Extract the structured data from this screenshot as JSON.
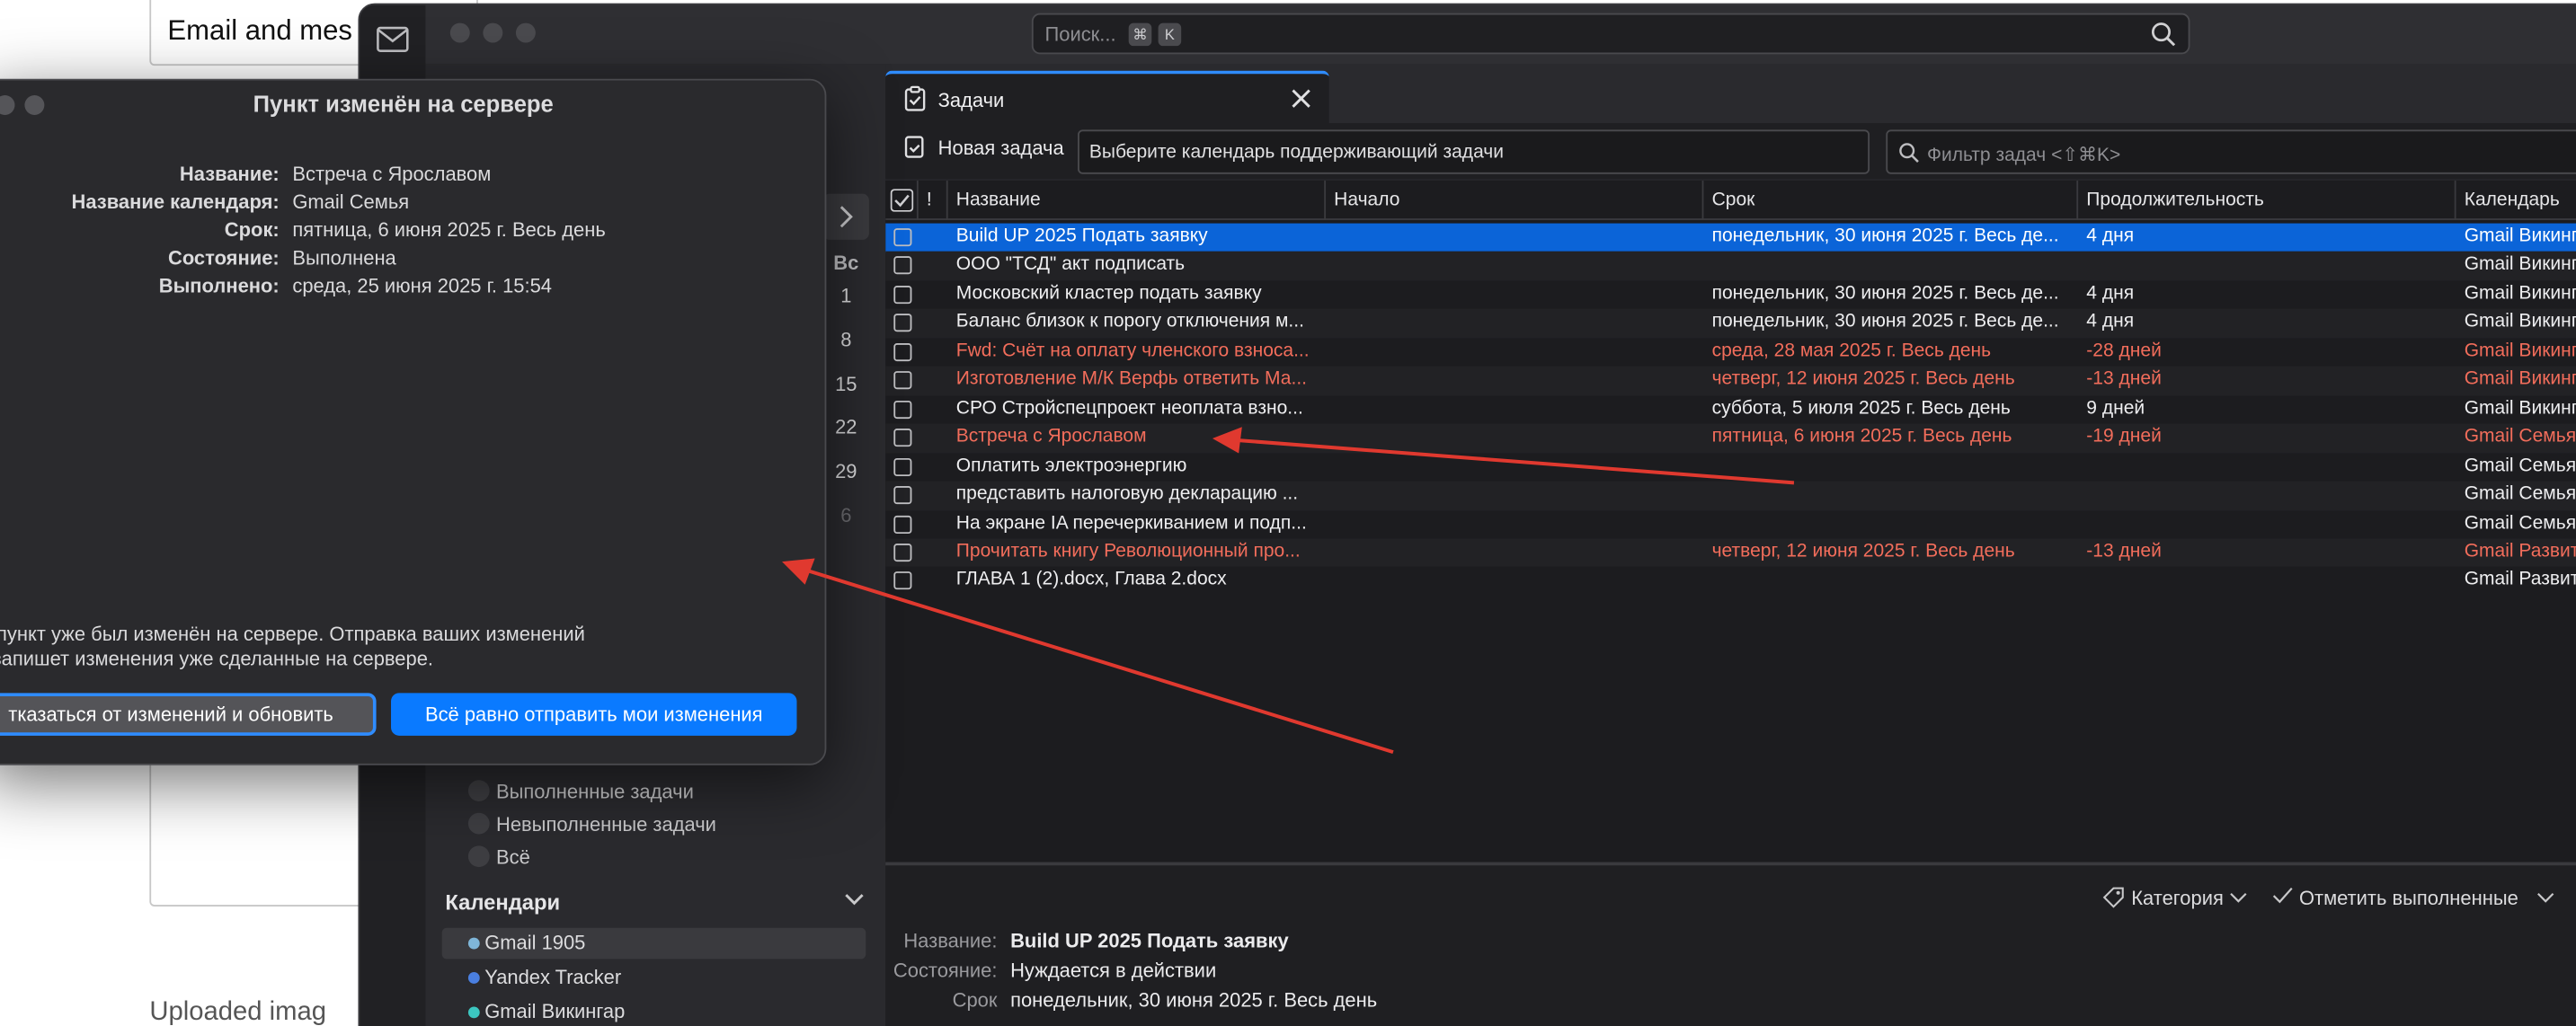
{
  "background": {
    "top_box_text": "Email and mes",
    "bottom_text": "Uploaded imag"
  },
  "app": {
    "search": {
      "placeholder": "Поиск...",
      "key1": "⌘",
      "key2": "K"
    },
    "mini_calendar": {
      "header": "Вс",
      "days": [
        "1",
        "8",
        "15",
        "22",
        "29",
        "6"
      ]
    },
    "filters": [
      {
        "label": "Выполненные задачи"
      },
      {
        "label": "Невыполненные задачи"
      },
      {
        "label": "Всё"
      }
    ],
    "calendars": {
      "title": "Календари",
      "items": [
        {
          "label": "Gmail 1905",
          "color": "#7fb6d9"
        },
        {
          "label": "Yandex Tracker",
          "color": "#4a7fe0"
        },
        {
          "label": "Gmail Викингар",
          "color": "#3cc6c0"
        }
      ]
    },
    "tab": {
      "label": "Задачи"
    },
    "toolbar": {
      "new_task": "Новая задача",
      "calendar_select": "Выберите календарь поддерживающий задачи",
      "filter_placeholder": "Фильтр задач <⇧⌘K>"
    },
    "table": {
      "columns": {
        "priority": "!",
        "name": "Название",
        "start": "Начало",
        "due": "Срок",
        "duration": "Продолжительность",
        "calendar": "Календарь"
      },
      "rows": [
        {
          "name": "Build UP 2025 Подать заявку",
          "start": "",
          "due": "понедельник, 30 июня 2025 г. Весь де...",
          "duration": "4 дня",
          "calendar": "Gmail Викингар",
          "state": "sel"
        },
        {
          "name": " ООО \"ТСД\" акт подписать",
          "start": "",
          "due": "",
          "duration": "",
          "calendar": "Gmail Викингар",
          "state": ""
        },
        {
          "name": "Московский кластер подать заявку",
          "start": "",
          "due": "понедельник, 30 июня 2025 г. Весь де...",
          "duration": "4 дня",
          "calendar": "Gmail Викингар",
          "state": ""
        },
        {
          "name": "Баланс близок к порогу отключения м...",
          "start": "",
          "due": "понедельник, 30 июня 2025 г. Весь де...",
          "duration": "4 дня",
          "calendar": "Gmail Викингар",
          "state": ""
        },
        {
          "name": "Fwd: Счёт на оплату членского взноса...",
          "start": "",
          "due": "среда, 28 мая 2025 г. Весь день",
          "duration": "-28 дней",
          "calendar": "Gmail Викингар",
          "state": "over"
        },
        {
          "name": "Изготовление М/К Верфь ответить Ма...",
          "start": "",
          "due": "четверг, 12 июня 2025 г. Весь день",
          "duration": "-13 дней",
          "calendar": "Gmail Викингар",
          "state": "over"
        },
        {
          "name": "СРО Стройспецпроект неоплата взно...",
          "start": "",
          "due": "суббота, 5 июля 2025 г. Весь день",
          "duration": "9 дней",
          "calendar": "Gmail Викингар",
          "state": ""
        },
        {
          "name": "Встреча с Ярославом",
          "start": "",
          "due": "пятница, 6 июня 2025 г. Весь день",
          "duration": "-19 дней",
          "calendar": "Gmail Семья",
          "state": "over"
        },
        {
          "name": "Оплатить электроэнергию",
          "start": "",
          "due": "",
          "duration": "",
          "calendar": "Gmail Семья",
          "state": ""
        },
        {
          "name": "  представить налоговую декларацию ...",
          "start": "",
          "due": "",
          "duration": "",
          "calendar": "Gmail Семья",
          "state": ""
        },
        {
          "name": "На экране IA перечеркиванием и подп...",
          "start": "",
          "due": "",
          "duration": "",
          "calendar": "Gmail Семья",
          "state": ""
        },
        {
          "name": "Прочитать книгу Революционный про...",
          "start": "",
          "due": "четверг, 12 июня 2025 г. Весь день",
          "duration": "-13 дней",
          "calendar": "Gmail Развит",
          "state": "over"
        },
        {
          "name": "ГЛАВА 1 (2).docx, Глава 2.docx",
          "start": "",
          "due": "",
          "duration": "",
          "calendar": "Gmail Развит",
          "state": ""
        }
      ]
    },
    "detail": {
      "category": "Категория",
      "mark_done": "Отметить выполненные",
      "name_label": "Название:",
      "name_value": "Build UP 2025 Подать заявку",
      "status_label": "Состояние:",
      "status_value": "Нуждается в действии",
      "due_label": "Срок",
      "due_value": "понедельник, 30 июня 2025 г. Весь день"
    }
  },
  "dialog": {
    "title": "Пункт изменён на сервере",
    "fields": [
      {
        "label": "Название:",
        "value": "Встреча с Ярославом"
      },
      {
        "label": "Название календаря:",
        "value": "Gmail Семья"
      },
      {
        "label": "Срок:",
        "value": "пятница, 6 июня 2025 г. Весь день"
      },
      {
        "label": "Состояние:",
        "value": "Выполнена"
      },
      {
        "label": "Выполнено:",
        "value": "среда, 25 июня 2025 г. 15:54"
      }
    ],
    "message_line1": "т пункт уже был изменён на сервере. Отправка ваших изменений",
    "message_line2": "езапишет изменения уже сделанные на сервере.",
    "btn_discard": "тказаться от изменений и обновить",
    "btn_send": "Всё равно отправить мои изменения"
  },
  "colors": {
    "accent": "#0a7aff",
    "selection": "#0b64d8",
    "overdue": "#f26d5b",
    "annotation_arrow": "#e0392f"
  }
}
